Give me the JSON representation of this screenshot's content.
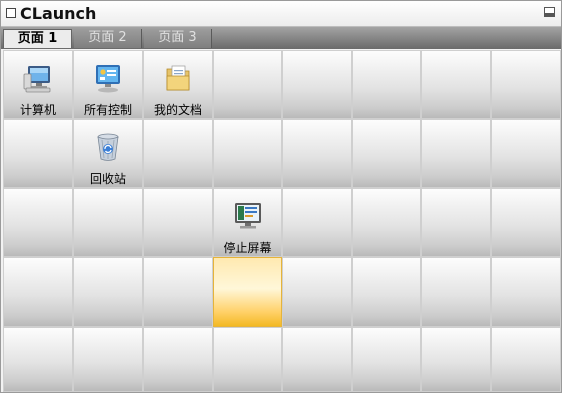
{
  "window": {
    "title": "CLaunch"
  },
  "tabs": [
    {
      "label": "页面 1",
      "active": true
    },
    {
      "label": "页面 2",
      "active": false
    },
    {
      "label": "页面 3",
      "active": false
    }
  ],
  "items": [
    {
      "id": "computer",
      "label": "计算机",
      "icon": "computer-icon"
    },
    {
      "id": "control-panel",
      "label": "所有控制",
      "icon": "control-panel-icon"
    },
    {
      "id": "documents",
      "label": "我的文档",
      "icon": "documents-folder-icon"
    },
    {
      "id": "recycle-bin",
      "label": "回收站",
      "icon": "recycle-bin-icon"
    },
    {
      "id": "screen-off",
      "label": "停止屏幕",
      "icon": "monitor-icon"
    }
  ],
  "colors": {
    "tab_bar": "#7f7f7f",
    "hover_cell": "#ffd066",
    "cell_bg": "#e3e3e3"
  }
}
